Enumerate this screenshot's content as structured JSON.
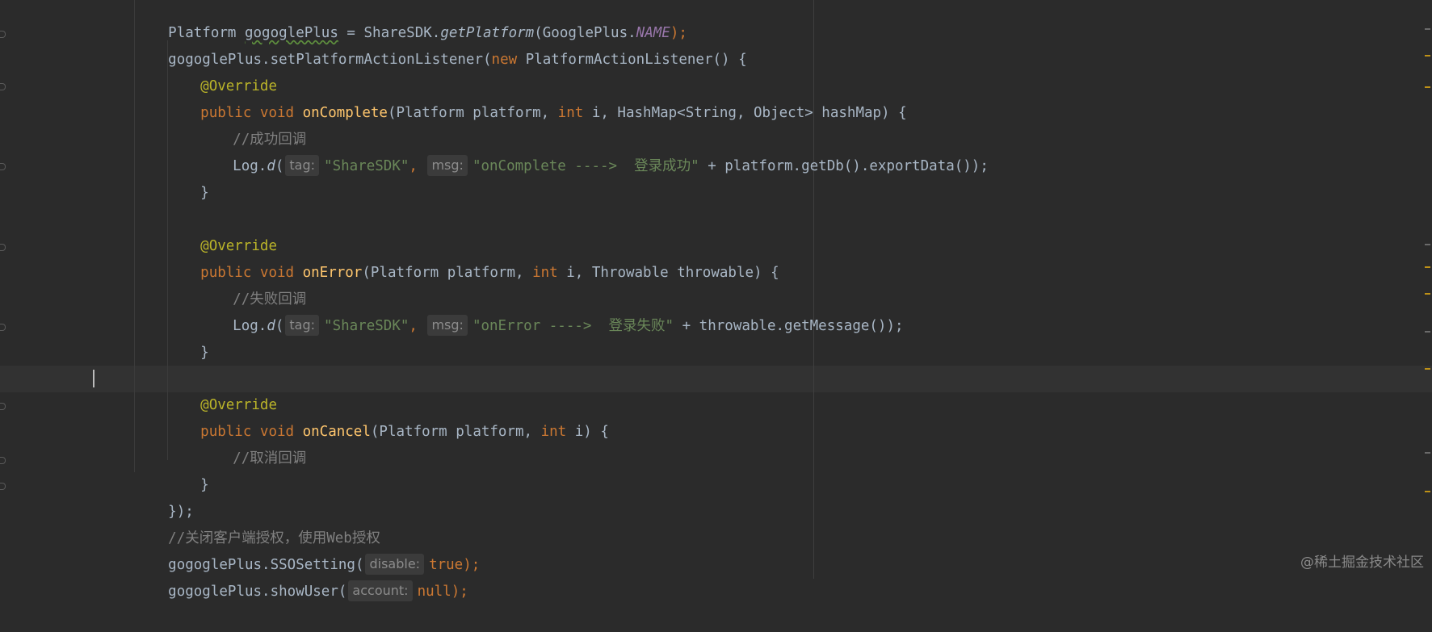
{
  "editor": {
    "lines": {
      "l1": {
        "a": "Platform ",
        "b": "gogoglePlus",
        "c": " = ShareSDK.",
        "d": "getPlatform",
        "e": "(GooglePlus.",
        "f": "NAME",
        "g": ");"
      },
      "l2": {
        "a": "gogoglePlus.setPlatformActionListener(",
        "b": "new ",
        "c": "PlatformActionListener() {"
      },
      "l3": {
        "a": "@Override"
      },
      "l4": {
        "a": "public void ",
        "b": "onComplete",
        "c": "(Platform platform, ",
        "d": "int ",
        "e": "i, HashMap<String, Object> hashMap) {"
      },
      "l5": {
        "a": "//成功回调"
      },
      "l6": {
        "a": "Log.",
        "b": "d",
        "c": "(",
        "hint1": "tag:",
        "d": "\"ShareSDK\"",
        "e": ", ",
        "hint2": "msg:",
        "f": "\"onComplete ---->  登录成功\"",
        "g": " + platform.getDb().exportData());"
      },
      "l7": {
        "a": "}"
      },
      "l8": {
        "a": "@Override"
      },
      "l9": {
        "a": "public void ",
        "b": "onError",
        "c": "(Platform platform, ",
        "d": "int ",
        "e": "i, Throwable throwable) {"
      },
      "l10": {
        "a": "//失败回调"
      },
      "l11": {
        "a": "Log.",
        "b": "d",
        "c": "(",
        "hint1": "tag:",
        "d": "\"ShareSDK\"",
        "e": ", ",
        "hint2": "msg:",
        "f": "\"onError ---->  登录失败\"",
        "g": " + throwable.getMessage());"
      },
      "l12": {
        "a": "}"
      },
      "l13": {
        "a": "@Override"
      },
      "l14": {
        "a": "public void ",
        "b": "onCancel",
        "c": "(Platform platform, ",
        "d": "int ",
        "e": "i) {"
      },
      "l15": {
        "a": "//取消回调"
      },
      "l16": {
        "a": "}"
      },
      "l17": {
        "a": "});"
      },
      "l18": {
        "a": "//关闭客户端授权，使用Web授权"
      },
      "l19": {
        "a": "gogoglePlus.SSOSetting(",
        "hint1": "disable:",
        "b": "true",
        "c": ");"
      },
      "l20": {
        "a": "gogoglePlus.showUser(",
        "hint1": "account:",
        "b": "null",
        "c": ");"
      }
    }
  },
  "colors": {
    "background": "#2b2b2b",
    "keyword": "#cc7832",
    "annotation": "#bbb529",
    "method": "#ffc66d",
    "string": "#6a8759",
    "comment": "#808080",
    "constant": "#9876aa"
  },
  "watermark": "@稀土掘金技术社区"
}
